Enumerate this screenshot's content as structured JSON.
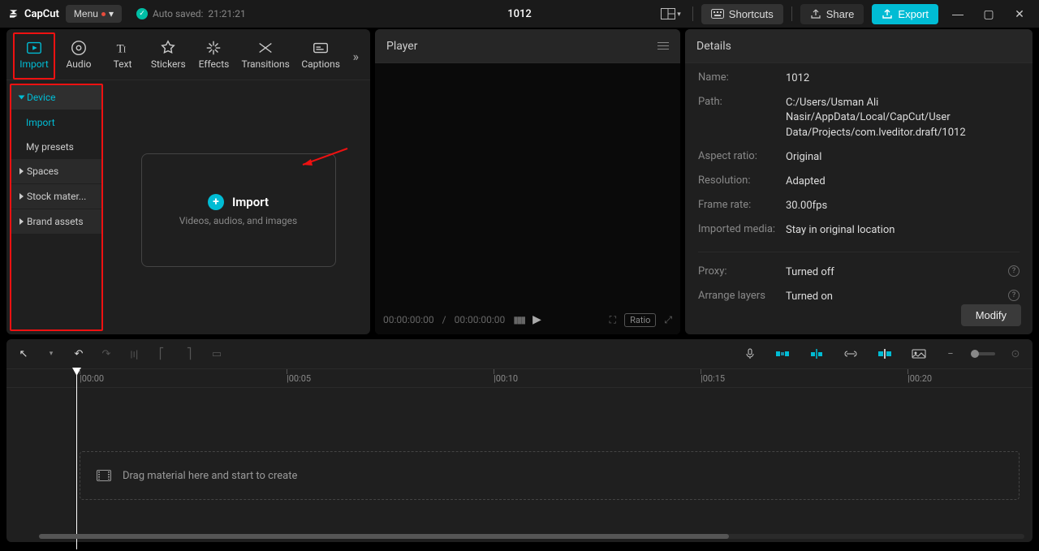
{
  "app": {
    "name": "CapCut"
  },
  "titlebar": {
    "menu": "Menu",
    "autosave_prefix": "Auto saved:",
    "autosave_time": "21:21:21",
    "title": "1012",
    "shortcuts": "Shortcuts",
    "share": "Share",
    "export": "Export"
  },
  "tabs": {
    "import": "Import",
    "audio": "Audio",
    "text": "Text",
    "stickers": "Stickers",
    "effects": "Effects",
    "transitions": "Transitions",
    "captions": "Captions"
  },
  "sidebar": {
    "device": "Device",
    "import": "Import",
    "presets": "My presets",
    "spaces": "Spaces",
    "stock": "Stock mater...",
    "brand": "Brand assets"
  },
  "import_box": {
    "label": "Import",
    "sub": "Videos, audios, and images"
  },
  "player": {
    "header": "Player",
    "time_current": "00:00:00:00",
    "time_sep": "/",
    "time_total": "00:00:00:00",
    "ratio": "Ratio"
  },
  "details": {
    "header": "Details",
    "name_k": "Name:",
    "name_v": "1012",
    "path_k": "Path:",
    "path_v": "C:/Users/Usman Ali Nasir/AppData/Local/CapCut/User Data/Projects/com.lveditor.draft/1012",
    "aspect_k": "Aspect ratio:",
    "aspect_v": "Original",
    "res_k": "Resolution:",
    "res_v": "Adapted",
    "fps_k": "Frame rate:",
    "fps_v": "30.00fps",
    "imp_k": "Imported media:",
    "imp_v": "Stay in original location",
    "proxy_k": "Proxy:",
    "proxy_v": "Turned off",
    "layers_k": "Arrange layers",
    "layers_v": "Turned on",
    "modify": "Modify"
  },
  "timeline": {
    "drop_hint": "Drag material here and start to create",
    "marks": [
      "00:00",
      "00:05",
      "00:10",
      "00:15",
      "00:20"
    ]
  }
}
